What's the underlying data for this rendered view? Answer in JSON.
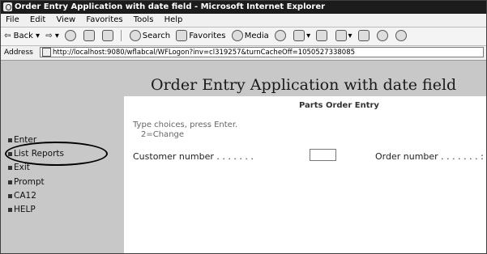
{
  "window": {
    "title": "Order Entry Application with date field - Microsoft Internet Explorer"
  },
  "menubar": {
    "items": [
      "File",
      "Edit",
      "View",
      "Favorites",
      "Tools",
      "Help"
    ]
  },
  "toolbar": {
    "back_label": "Back",
    "search_label": "Search",
    "favorites_label": "Favorites",
    "media_label": "Media"
  },
  "address": {
    "label": "Address",
    "url": "http://localhost:9080/wflabcal/WFLogon?inv=cl319257&turnCacheOff=1050527338085"
  },
  "page": {
    "app_title": "Order Entry Application with date field",
    "header": "Parts Order Entry",
    "instructions_line1": "Type choices, press Enter.",
    "instructions_line2": "2=Change",
    "customer_label": "Customer number . . . . . . .",
    "customer_value": "",
    "order_label": "Order number . . . . . . . :"
  },
  "sidebar": {
    "items": [
      {
        "label": "Enter"
      },
      {
        "label": "List Reports"
      },
      {
        "label": "Exit"
      },
      {
        "label": "Prompt"
      },
      {
        "label": "CA12"
      },
      {
        "label": "HELP"
      }
    ]
  }
}
